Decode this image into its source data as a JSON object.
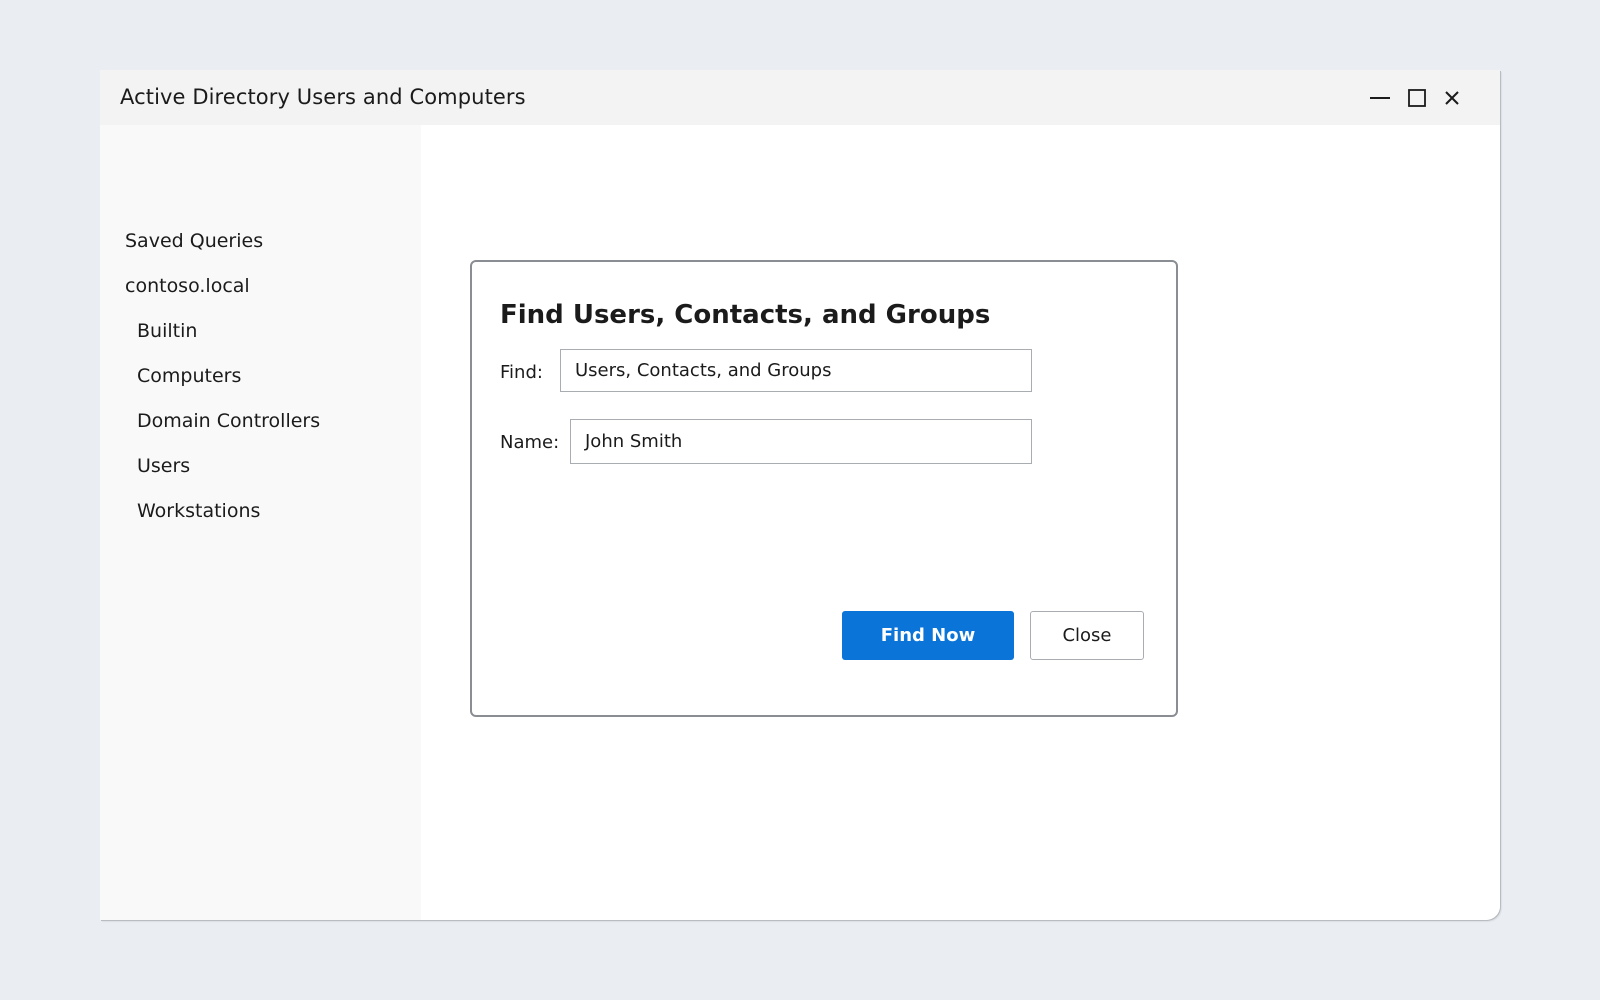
{
  "window": {
    "title": "Active Directory Users and Computers",
    "controls": {
      "minimize_icon": "minimize-icon",
      "maximize_icon": "maximize-icon",
      "close_icon": "close-icon"
    }
  },
  "sidebar": {
    "items": [
      {
        "label": "Saved Queries",
        "level": 0
      },
      {
        "label": "contoso.local",
        "level": 0
      },
      {
        "label": "Builtin",
        "level": 1
      },
      {
        "label": "Computers",
        "level": 1
      },
      {
        "label": "Domain Controllers",
        "level": 1
      },
      {
        "label": "Users",
        "level": 1
      },
      {
        "label": "Workstations",
        "level": 1
      }
    ]
  },
  "dialog": {
    "title": "Find Users, Contacts, and Groups",
    "find_label": "Find:",
    "find_value": "Users, Contacts, and Groups",
    "name_label": "Name:",
    "name_value": "John Smith",
    "find_now_label": "Find Now",
    "close_label": "Close"
  },
  "colors": {
    "accent": "#0a74d8",
    "background": "#eaeef2",
    "titlebar": "#f3f3f3",
    "sidebar": "#f9f9f9"
  }
}
